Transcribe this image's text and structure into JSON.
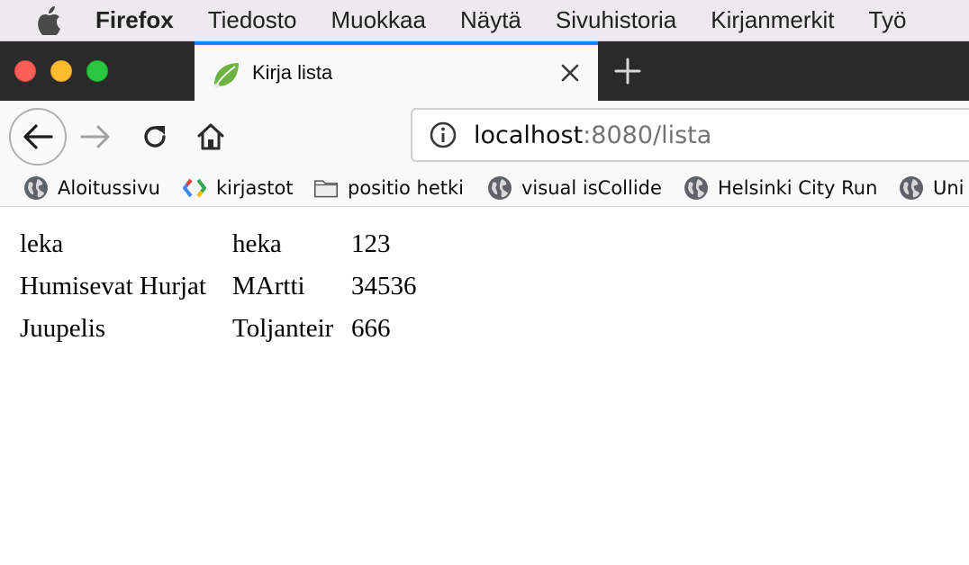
{
  "menubar": {
    "app_name": "Firefox",
    "items": [
      "Tiedosto",
      "Muokkaa",
      "Näytä",
      "Sivuhistoria",
      "Kirjanmerkit",
      "Työ"
    ]
  },
  "tab": {
    "title": "Kirja lista",
    "favicon": "spring-leaf-icon"
  },
  "navbar": {
    "url_host": "localhost",
    "url_rest": ":8080/lista"
  },
  "bookmarks": [
    {
      "label": "Aloitussivu",
      "icon": "globe-icon"
    },
    {
      "label": "kirjastot",
      "icon": "google-icon"
    },
    {
      "label": "positio hetki",
      "icon": "folder-icon"
    },
    {
      "label": "visual isCollide",
      "icon": "globe-icon"
    },
    {
      "label": "Helsinki City Run",
      "icon": "globe-icon"
    },
    {
      "label": "Uni",
      "icon": "globe-icon"
    }
  ],
  "books": [
    {
      "title": "leka",
      "author": "heka",
      "value": "123"
    },
    {
      "title": "Humisevat Hurjat",
      "author": "MArtti",
      "value": "34536"
    },
    {
      "title": "Juupelis",
      "author": "Toljanteir",
      "value": "666"
    }
  ],
  "colors": {
    "tab_accent": "#0a84ff",
    "tabstrip_bg": "#2b2a2b",
    "toolbar_bg": "#f9f9fa"
  }
}
